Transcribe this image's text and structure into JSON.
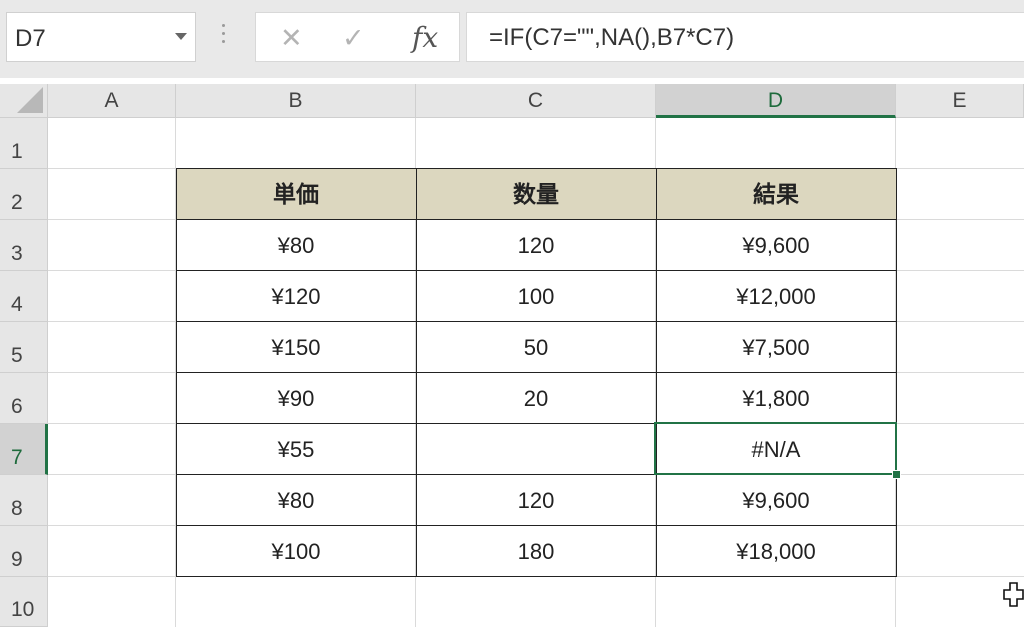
{
  "name_box": "D7",
  "formula": "=IF(C7=\"\",NA(),B7*C7)",
  "formula_buttons": {
    "cancel": "✕",
    "enter": "✓",
    "fx": "fx"
  },
  "columns": [
    "A",
    "B",
    "C",
    "D",
    "E"
  ],
  "rows": [
    "1",
    "2",
    "3",
    "4",
    "5",
    "6",
    "7",
    "8",
    "9",
    "10"
  ],
  "table": {
    "headers": [
      "単価",
      "数量",
      "結果"
    ],
    "rows": [
      [
        "¥80",
        "120",
        "¥9,600"
      ],
      [
        "¥120",
        "100",
        "¥12,000"
      ],
      [
        "¥150",
        "50",
        "¥7,500"
      ],
      [
        "¥90",
        "20",
        "¥1,800"
      ],
      [
        "¥55",
        "",
        "#N/A"
      ],
      [
        "¥80",
        "120",
        "¥9,600"
      ],
      [
        "¥100",
        "180",
        "¥18,000"
      ]
    ]
  },
  "selected_cell": "D7",
  "colors": {
    "accent": "#217346",
    "header_fill": "#dcd7bf"
  }
}
